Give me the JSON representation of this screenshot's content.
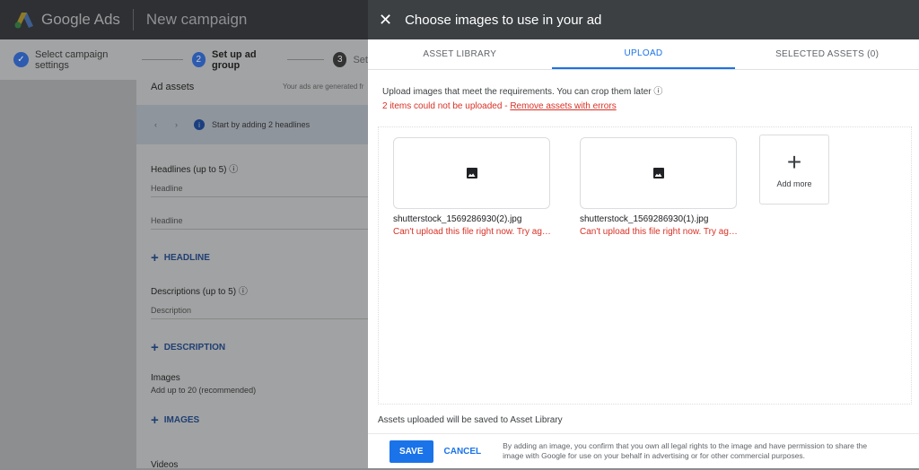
{
  "app": {
    "brand": "Google Ads",
    "title": "New campaign"
  },
  "stepper": {
    "steps": [
      {
        "num": "",
        "label": "Select campaign settings",
        "state": "done"
      },
      {
        "num": "2",
        "label": "Set up ad group",
        "state": "current"
      },
      {
        "num": "3",
        "label": "Set",
        "state": "todo"
      }
    ]
  },
  "card": {
    "section": "Ad assets",
    "note": "Your ads are generated fr",
    "banner": "Start by adding 2 headlines",
    "headlines_label": "Headlines (up to 5)",
    "headline_placeholder": "Headline",
    "add_headline": "HEADLINE",
    "descriptions_label": "Descriptions (up to 5)",
    "description_placeholder": "Description",
    "add_description": "DESCRIPTION",
    "images_label": "Images",
    "images_hint": "Add up to 20 (recommended)",
    "add_images": "IMAGES",
    "videos_label": "Videos"
  },
  "dialog": {
    "title": "Choose images to use in your ad",
    "tabs": [
      {
        "label": "ASSET LIBRARY"
      },
      {
        "label": "UPLOAD",
        "active": true
      },
      {
        "label": "SELECTED ASSETS (0)"
      }
    ],
    "requirements": "Upload images that meet the requirements. You can crop them later",
    "error_summary": "2 items could not be uploaded - ",
    "error_link": "Remove assets with errors",
    "files": [
      {
        "name": "shutterstock_1569286930(2).jpg",
        "error": "Can't upload this file right now. Try again later."
      },
      {
        "name": "shutterstock_1569286930(1).jpg",
        "error": "Can't upload this file right now. Try again later."
      }
    ],
    "add_more": "Add more",
    "saved_note": "Assets uploaded will be saved to Asset Library",
    "save": "SAVE",
    "cancel": "CANCEL",
    "legal": "By adding an image, you confirm that you own all legal rights to the image and have permission to share the image with Google for use on your behalf in advertising or for other commercial purposes."
  },
  "colors": {
    "accent": "#1a73e8",
    "error": "#d93025",
    "header": "#3c4043"
  }
}
